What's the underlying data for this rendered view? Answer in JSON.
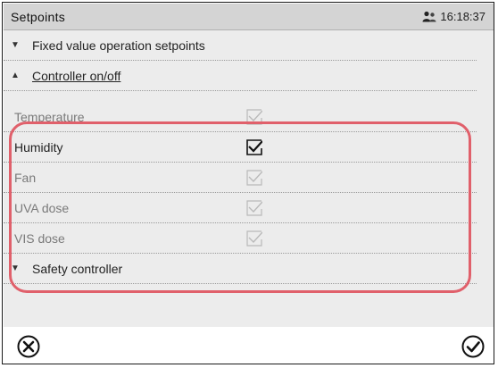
{
  "header": {
    "title": "Setpoints",
    "time": "16:18:37"
  },
  "sections": {
    "fixed_value": "Fixed value operation setpoints",
    "controller": "Controller on/off",
    "safety": "Safety controller"
  },
  "items": [
    {
      "label": "Temperature",
      "checked": true,
      "enabled": false
    },
    {
      "label": "Humidity",
      "checked": true,
      "enabled": true
    },
    {
      "label": "Fan",
      "checked": true,
      "enabled": false
    },
    {
      "label": "UVA dose",
      "checked": true,
      "enabled": false
    },
    {
      "label": "VIS dose",
      "checked": true,
      "enabled": false
    }
  ],
  "footer": {
    "cancel_icon": "close-circle-icon",
    "confirm_icon": "check-circle-icon"
  },
  "colors": {
    "highlight": "#e0606b",
    "header_bg": "#d4d4d4",
    "content_bg": "#ececec"
  }
}
